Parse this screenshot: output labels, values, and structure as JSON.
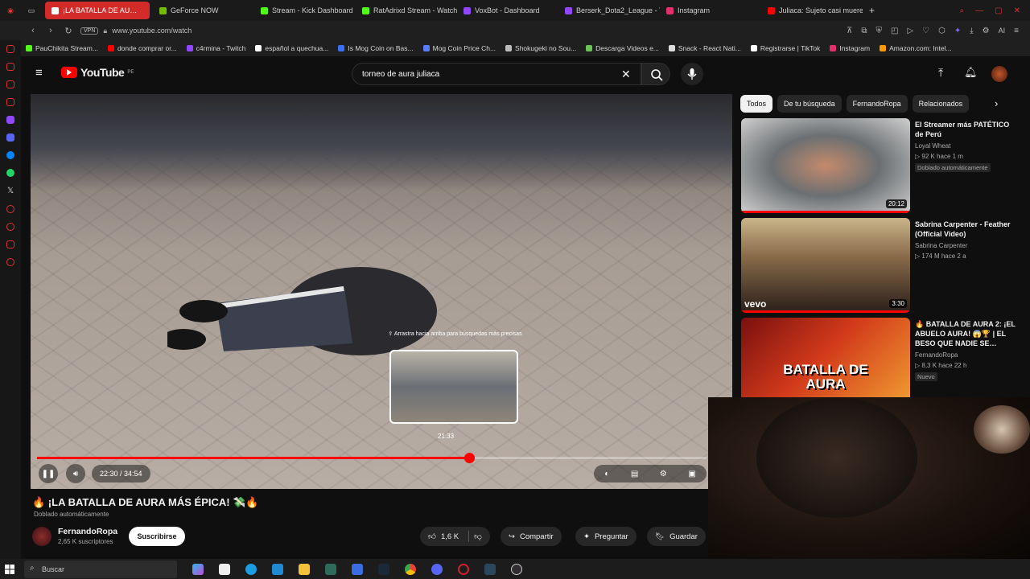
{
  "browser": {
    "tabs": [
      {
        "title": "¡LA BATALLA DE AU…",
        "active": true,
        "color": "#ff0000"
      },
      {
        "title": "GeForce NOW",
        "color": "#76b900"
      },
      {
        "title": "Stream - Kick Dashboard",
        "color": "#53fc18"
      },
      {
        "title": "RatAdrixd Stream - Watch",
        "color": "#53fc18"
      },
      {
        "title": "VoxBot - Dashboard",
        "color": "#9146ff"
      },
      {
        "title": "Berserk_Dota2_League - T…",
        "color": "#9146ff"
      },
      {
        "title": "Instagram",
        "color": "#e1306c"
      },
      {
        "title": "Juliaca: Sujeto casi muere …",
        "color": "#ff0000"
      }
    ],
    "url": "www.youtube.com/watch",
    "vpn_label": "VPN",
    "ai_label": "AI",
    "bookmarks": [
      {
        "label": "PauChikita Stream...",
        "color": "#53fc18"
      },
      {
        "label": "donde comprar or...",
        "color": "#ff0000"
      },
      {
        "label": "c4rmina - Twitch",
        "color": "#9146ff"
      },
      {
        "label": "español a quechua...",
        "color": "#ffffff"
      },
      {
        "label": "Is Mog Coin on Bas...",
        "color": "#3b6ef5"
      },
      {
        "label": "Mog Coin Price Ch...",
        "color": "#5b7cf7"
      },
      {
        "label": "Shokugeki no Sou...",
        "color": "#bbbbbb"
      },
      {
        "label": "Descarga Videos e...",
        "color": "#6ac259"
      },
      {
        "label": "Snack - React Nati...",
        "color": "#dddddd"
      },
      {
        "label": "Registrarse | TikTok",
        "color": "#ffffff"
      },
      {
        "label": "Instagram",
        "color": "#e1306c"
      },
      {
        "label": "Amazon.com: Intel...",
        "color": "#ff9900"
      }
    ]
  },
  "youtube": {
    "logo_text": "YouTube",
    "logo_region": "PE",
    "search_query": "torneo de aura juliaca",
    "player": {
      "preview_hint": "⇪ Arrastra hacia arriba para búsquedas más precisas",
      "preview_time": "21:33",
      "current_time": "22:30",
      "total_time": "34:54",
      "time_display": "22:30 / 34:54",
      "progress_fraction": 0.645
    },
    "video": {
      "title": "🔥 ¡LA BATALLA DE AURA MÁS ÉPICA! 💸🔥",
      "dubbed": "Doblado automáticamente",
      "channel": "FernandoRopa",
      "subscribers": "2,65 K suscriptores",
      "subscribe_label": "Suscribirse",
      "likes": "1,6 K",
      "share_label": "Compartir",
      "ask_label": "Preguntar",
      "save_label": "Guardar"
    },
    "chips": [
      "Todos",
      "De tu búsqueda",
      "FernandoRopa",
      "Relacionados"
    ],
    "recommendations": [
      {
        "title": "El Streamer más PATÉTICO de Perú",
        "channel": "Loyal Wheat",
        "meta": "▷ 92 K  hace 1 m",
        "badge": "Doblado automáticamente",
        "duration": "20:12"
      },
      {
        "title": "Sabrina Carpenter - Feather (Official Video)",
        "channel": "Sabrina Carpenter",
        "meta": "▷ 174 M  hace 2 a",
        "duration": "3:30",
        "thumb_brand": "vevo"
      },
      {
        "title": "🔥 BATALLA DE AURA 2: ¡EL ABUELO AURA! 😱🏆 | EL BESO QUE NADIE SE…",
        "channel": "FernandoRopa",
        "meta": "▷ 8,3 K  hace 22 h",
        "badge": "Nuevo",
        "thumb_text": "BATALLA DE AURA"
      }
    ]
  },
  "taskbar": {
    "search_placeholder": "Buscar"
  },
  "colors": {
    "youtube_red": "#ff0000",
    "background": "#0f0f0f",
    "chip_bg": "#272727"
  }
}
